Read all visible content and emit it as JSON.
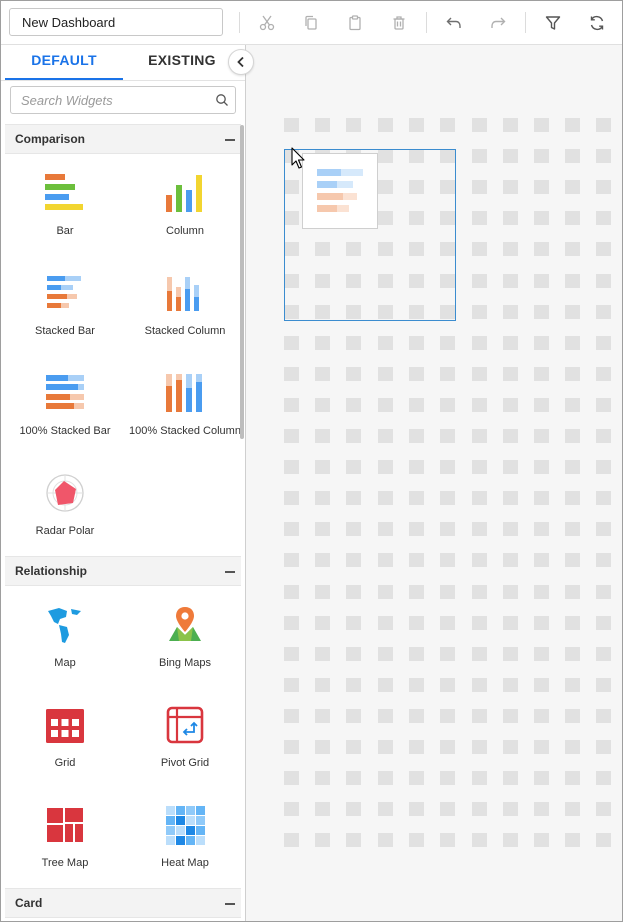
{
  "header": {
    "dashboard_title": "New Dashboard",
    "toolbar_icons": [
      "cut-icon",
      "copy-icon",
      "paste-icon",
      "delete-icon",
      "undo-icon",
      "redo-icon",
      "filter-icon",
      "refresh-icon"
    ]
  },
  "panel": {
    "tabs": [
      {
        "label": "DEFAULT",
        "active": true
      },
      {
        "label": "EXISTING",
        "active": false
      }
    ],
    "search": {
      "placeholder": "Search Widgets",
      "value": ""
    },
    "sections": [
      {
        "title": "Comparison",
        "toggle": "collapse",
        "widgets": [
          {
            "label": "Bar",
            "icon": "bar-chart-icon"
          },
          {
            "label": "Column",
            "icon": "column-chart-icon"
          },
          {
            "label": "Stacked Bar",
            "icon": "stacked-bar-icon"
          },
          {
            "label": "Stacked Column",
            "icon": "stacked-column-icon"
          },
          {
            "label": "100% Stacked Bar",
            "icon": "percent-stacked-bar-icon"
          },
          {
            "label": "100% Stacked Column",
            "icon": "percent-stacked-column-icon"
          },
          {
            "label": "Radar Polar",
            "icon": "radar-polar-icon"
          }
        ]
      },
      {
        "title": "Relationship",
        "toggle": "collapse",
        "widgets": [
          {
            "label": "Map",
            "icon": "world-map-icon"
          },
          {
            "label": "Bing Maps",
            "icon": "bing-maps-icon"
          },
          {
            "label": "Grid",
            "icon": "grid-icon"
          },
          {
            "label": "Pivot Grid",
            "icon": "pivot-grid-icon"
          },
          {
            "label": "Tree Map",
            "icon": "tree-map-icon"
          },
          {
            "label": "Heat Map",
            "icon": "heat-map-icon"
          }
        ]
      },
      {
        "title": "Card",
        "toggle": "collapse",
        "widgets": []
      }
    ]
  },
  "canvas": {
    "drag_preview_widget": "stacked-bar-icon"
  },
  "colors": {
    "accent": "#1a73e8",
    "selection_border": "#3b8ccf",
    "orange": "#e8793a",
    "blue": "#4a9cf0",
    "light_blue": "#a9d0f7",
    "peach": "#f6c8ad",
    "green": "#6cbf3c",
    "yellow": "#f2d530",
    "red": "#d9363e"
  }
}
